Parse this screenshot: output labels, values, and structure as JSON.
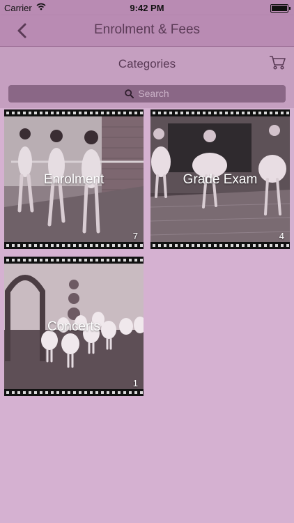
{
  "status_bar": {
    "carrier": "Carrier",
    "time": "9:42 PM"
  },
  "nav": {
    "title": "Enrolment & Fees"
  },
  "categories_header": {
    "title": "Categories"
  },
  "search": {
    "placeholder": "Search"
  },
  "tiles": [
    {
      "label": "Enrolment",
      "count": "7"
    },
    {
      "label": "Grade Exam",
      "count": "4"
    },
    {
      "label": "Concerts",
      "count": "1"
    }
  ],
  "colors": {
    "accent": "#b98bb3",
    "background": "#d5b1d1",
    "title_text": "#5a3a56"
  }
}
